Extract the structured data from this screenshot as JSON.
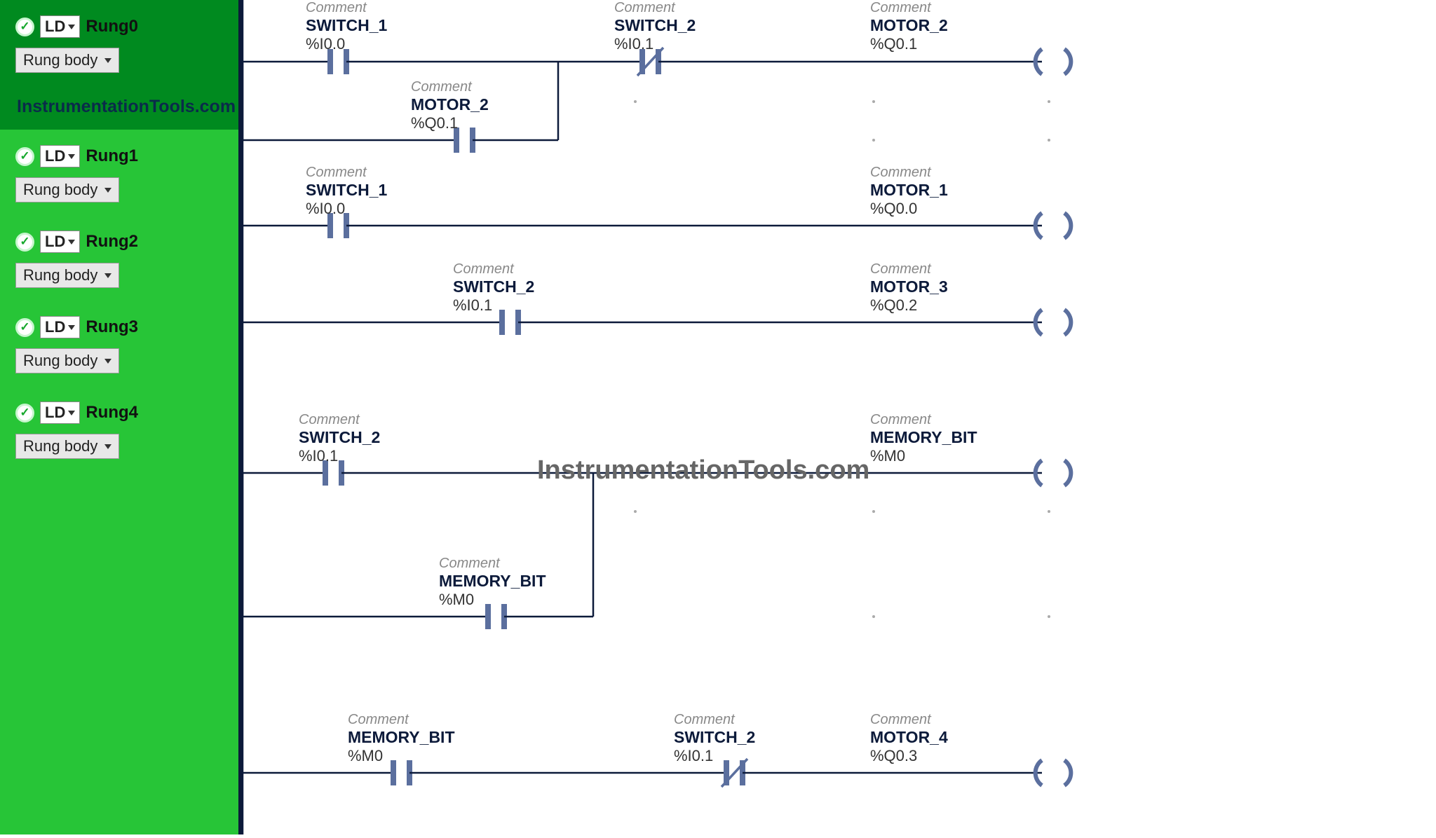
{
  "sidebar": {
    "watermark": "InstrumentationTools.com",
    "rungs": [
      {
        "ld": "LD",
        "name": "Rung0",
        "body": "Rung body"
      },
      {
        "ld": "LD",
        "name": "Rung1",
        "body": "Rung body"
      },
      {
        "ld": "LD",
        "name": "Rung2",
        "body": "Rung body"
      },
      {
        "ld": "LD",
        "name": "Rung3",
        "body": "Rung body"
      },
      {
        "ld": "LD",
        "name": "Rung4",
        "body": "Rung body"
      }
    ]
  },
  "canvas": {
    "watermark": "InstrumentationTools.com",
    "comment_label": "Comment",
    "elements": {
      "r0_no1": {
        "name": "SWITCH_1",
        "addr": "%I0.0"
      },
      "r0_nc1": {
        "name": "SWITCH_2",
        "addr": "%I0.1"
      },
      "r0_coil": {
        "name": "MOTOR_2",
        "addr": "%Q0.1"
      },
      "r0_br_no": {
        "name": "MOTOR_2",
        "addr": "%Q0.1"
      },
      "r1_no1": {
        "name": "SWITCH_1",
        "addr": "%I0.0"
      },
      "r1_coil": {
        "name": "MOTOR_1",
        "addr": "%Q0.0"
      },
      "r2_no1": {
        "name": "SWITCH_2",
        "addr": "%I0.1"
      },
      "r2_coil": {
        "name": "MOTOR_3",
        "addr": "%Q0.2"
      },
      "r3_no1": {
        "name": "SWITCH_2",
        "addr": "%I0.1"
      },
      "r3_coil": {
        "name": "MEMORY_BIT",
        "addr": "%M0"
      },
      "r3_br_no": {
        "name": "MEMORY_BIT",
        "addr": "%M0"
      },
      "r4_no1": {
        "name": "MEMORY_BIT",
        "addr": "%M0"
      },
      "r4_nc1": {
        "name": "SWITCH_2",
        "addr": "%I0.1"
      },
      "r4_coil": {
        "name": "MOTOR_4",
        "addr": "%Q0.3"
      }
    }
  }
}
